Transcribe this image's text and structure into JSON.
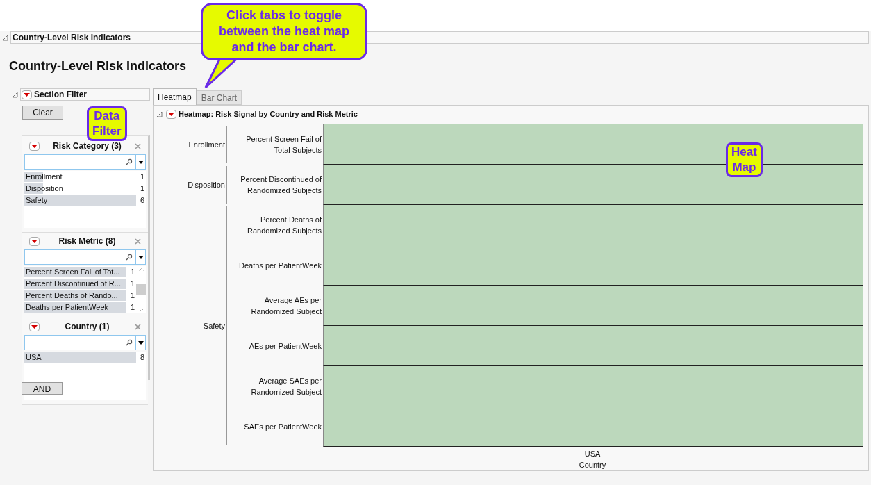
{
  "outline_header": {
    "title": "Country-Level Risk Indicators",
    "expanded": true
  },
  "report_title": "Country-Level Risk Indicators",
  "section_filter": {
    "title": "Section Filter",
    "expanded": true,
    "clear_button": "Clear",
    "and_button": "AND",
    "filters": [
      {
        "title": "Risk Category (3)",
        "items": [
          {
            "label": "Enrollment",
            "count": "1",
            "level": 0.17
          },
          {
            "label": "Disposition",
            "count": "1",
            "level": 0.17
          },
          {
            "label": "Safety",
            "count": "6",
            "level": 1
          }
        ]
      },
      {
        "title": "Risk Metric (8)",
        "items": [
          {
            "label": "Percent Screen Fail of Tot...",
            "count": "1",
            "level": 1
          },
          {
            "label": "Percent Discontinued of R...",
            "count": "1",
            "level": 1
          },
          {
            "label": "Percent Deaths of Rando...",
            "count": "1",
            "level": 1
          },
          {
            "label": "Deaths per PatientWeek",
            "count": "1",
            "level": 1
          }
        ]
      },
      {
        "title": "Country (1)",
        "items": [
          {
            "label": "USA",
            "count": "8",
            "level": 1
          }
        ]
      }
    ]
  },
  "tabs": [
    {
      "label": "Heatmap",
      "selected": true
    },
    {
      "label": "Bar Chart",
      "selected": false
    }
  ],
  "heatmap": {
    "title": "Heatmap: Risk Signal by Country and Risk Metric",
    "expanded": true,
    "x_category": "USA",
    "x_axis_label": "Country",
    "groups": [
      {
        "label": "Enrollment",
        "rows": [
          {
            "label": "Percent Screen Fail of Total Subjects",
            "color": "#bcd8bc"
          }
        ]
      },
      {
        "label": "Disposition",
        "rows": [
          {
            "label": "Percent Discontinued of Randomized Subjects",
            "color": "#bcd8bc"
          }
        ]
      },
      {
        "label": "Safety",
        "rows": [
          {
            "label": "Percent Deaths of Randomized Subjects",
            "color": "#bcd8bc"
          },
          {
            "label": "Deaths per PatientWeek",
            "color": "#bcd8bc"
          },
          {
            "label": "Average AEs per Randomized Subject",
            "color": "#bcd8bc"
          },
          {
            "label": "AEs per PatientWeek",
            "color": "#bcd8bc"
          },
          {
            "label": "Average SAEs per Randomized Subject",
            "color": "#bcd8bc"
          },
          {
            "label": "SAEs per PatientWeek",
            "color": "#bcd8bc"
          }
        ]
      }
    ]
  },
  "callouts": [
    {
      "kind": "speech",
      "text": "Click tabs to toggle between the heat map and the bar chart."
    },
    {
      "kind": "label",
      "text": "Data Filter"
    },
    {
      "kind": "label",
      "text": "Heat Map"
    }
  ]
}
